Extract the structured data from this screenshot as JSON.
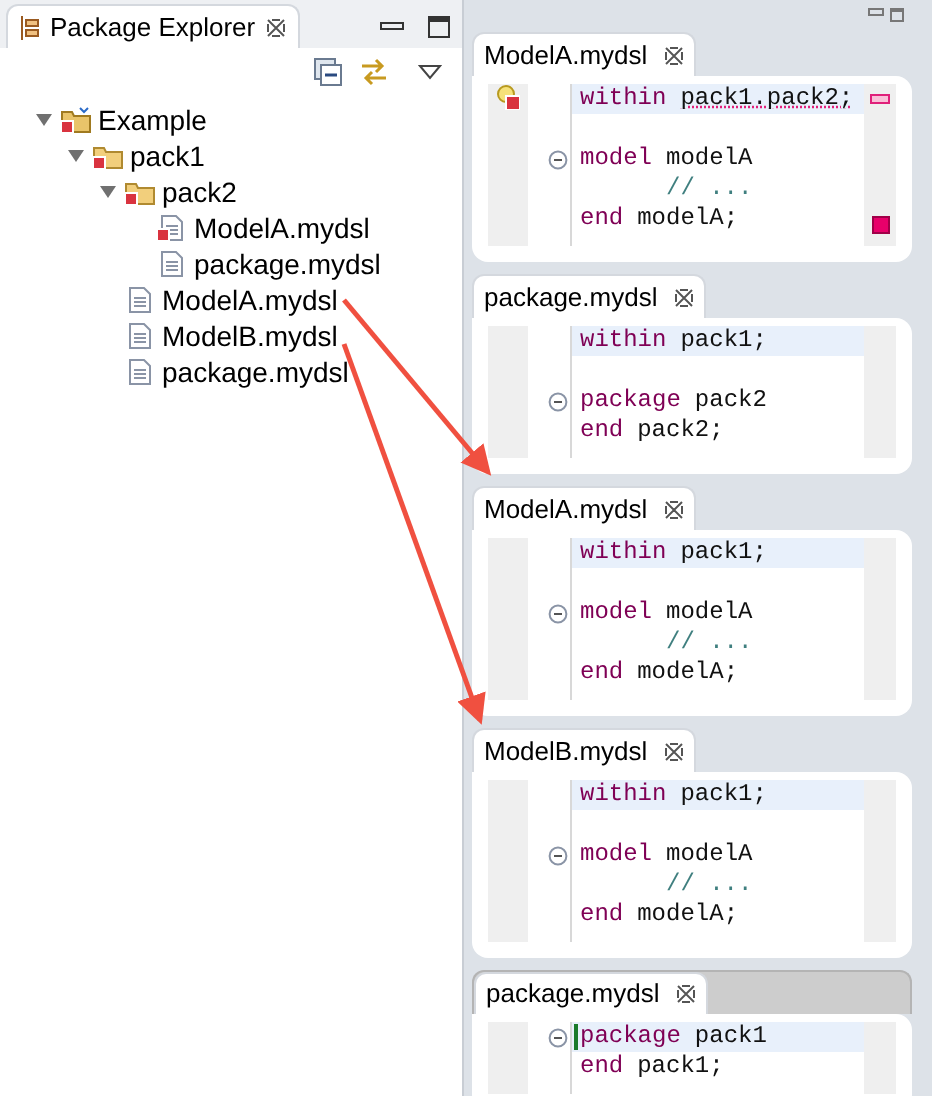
{
  "explorer": {
    "title": "Package Explorer",
    "tree": [
      {
        "label": "Example",
        "kind": "project",
        "error": true,
        "expanded": true,
        "children": [
          {
            "label": "pack1",
            "kind": "package",
            "error": true,
            "expanded": true,
            "children": [
              {
                "label": "pack2",
                "kind": "package",
                "error": true,
                "expanded": true,
                "children": [
                  {
                    "label": "ModelA.mydsl",
                    "kind": "file",
                    "error": true
                  },
                  {
                    "label": "package.mydsl",
                    "kind": "file",
                    "error": false
                  }
                ]
              },
              {
                "label": "ModelA.mydsl",
                "kind": "file",
                "error": false
              },
              {
                "label": "ModelB.mydsl",
                "kind": "file",
                "error": false
              },
              {
                "label": "package.mydsl",
                "kind": "file",
                "error": false
              }
            ]
          }
        ]
      }
    ]
  },
  "editors": [
    {
      "title": "ModelA.mydsl",
      "focused": false,
      "overview_error": true,
      "lines": [
        {
          "kind": "code",
          "keyword": "within",
          "text": "pack1.pack2;",
          "current": true,
          "fold": false,
          "error": true
        },
        {
          "kind": "blank"
        },
        {
          "kind": "code",
          "keyword": "model",
          "text": "modelA",
          "current": false,
          "fold": true,
          "error": false
        },
        {
          "kind": "comment",
          "text": "// ..."
        },
        {
          "kind": "code",
          "keyword": "end",
          "text": "modelA;",
          "current": false,
          "fold": false,
          "error": false
        }
      ]
    },
    {
      "title": "package.mydsl",
      "focused": false,
      "overview_error": false,
      "lines": [
        {
          "kind": "code",
          "keyword": "within",
          "text": "pack1;",
          "current": true,
          "fold": false,
          "error": false
        },
        {
          "kind": "blank"
        },
        {
          "kind": "code",
          "keyword": "package",
          "text": "pack2",
          "current": false,
          "fold": true,
          "error": false
        },
        {
          "kind": "code",
          "keyword": "end",
          "text": "pack2;",
          "current": false,
          "fold": false,
          "error": false
        }
      ]
    },
    {
      "title": "ModelA.mydsl",
      "focused": false,
      "overview_error": false,
      "lines": [
        {
          "kind": "code",
          "keyword": "within",
          "text": "pack1;",
          "current": true,
          "fold": false,
          "error": false
        },
        {
          "kind": "blank"
        },
        {
          "kind": "code",
          "keyword": "model",
          "text": "modelA",
          "current": false,
          "fold": true,
          "error": false
        },
        {
          "kind": "comment",
          "text": "// ..."
        },
        {
          "kind": "code",
          "keyword": "end",
          "text": "modelA;",
          "current": false,
          "fold": false,
          "error": false
        }
      ]
    },
    {
      "title": "ModelB.mydsl",
      "focused": false,
      "overview_error": false,
      "lines": [
        {
          "kind": "code",
          "keyword": "within",
          "text": "pack1;",
          "current": true,
          "fold": false,
          "error": false
        },
        {
          "kind": "blank"
        },
        {
          "kind": "code",
          "keyword": "model",
          "text": "modelA",
          "current": false,
          "fold": true,
          "error": false
        },
        {
          "kind": "comment",
          "text": "// ..."
        },
        {
          "kind": "code",
          "keyword": "end",
          "text": "modelA;",
          "current": false,
          "fold": false,
          "error": false
        }
      ]
    },
    {
      "title": "package.mydsl",
      "focused": true,
      "overview_error": false,
      "lines": [
        {
          "kind": "code",
          "keyword": "package",
          "text": "pack1",
          "current": true,
          "fold": true,
          "error": false
        },
        {
          "kind": "code",
          "keyword": "end",
          "text": "pack1;",
          "current": false,
          "fold": false,
          "error": false
        }
      ]
    }
  ]
}
